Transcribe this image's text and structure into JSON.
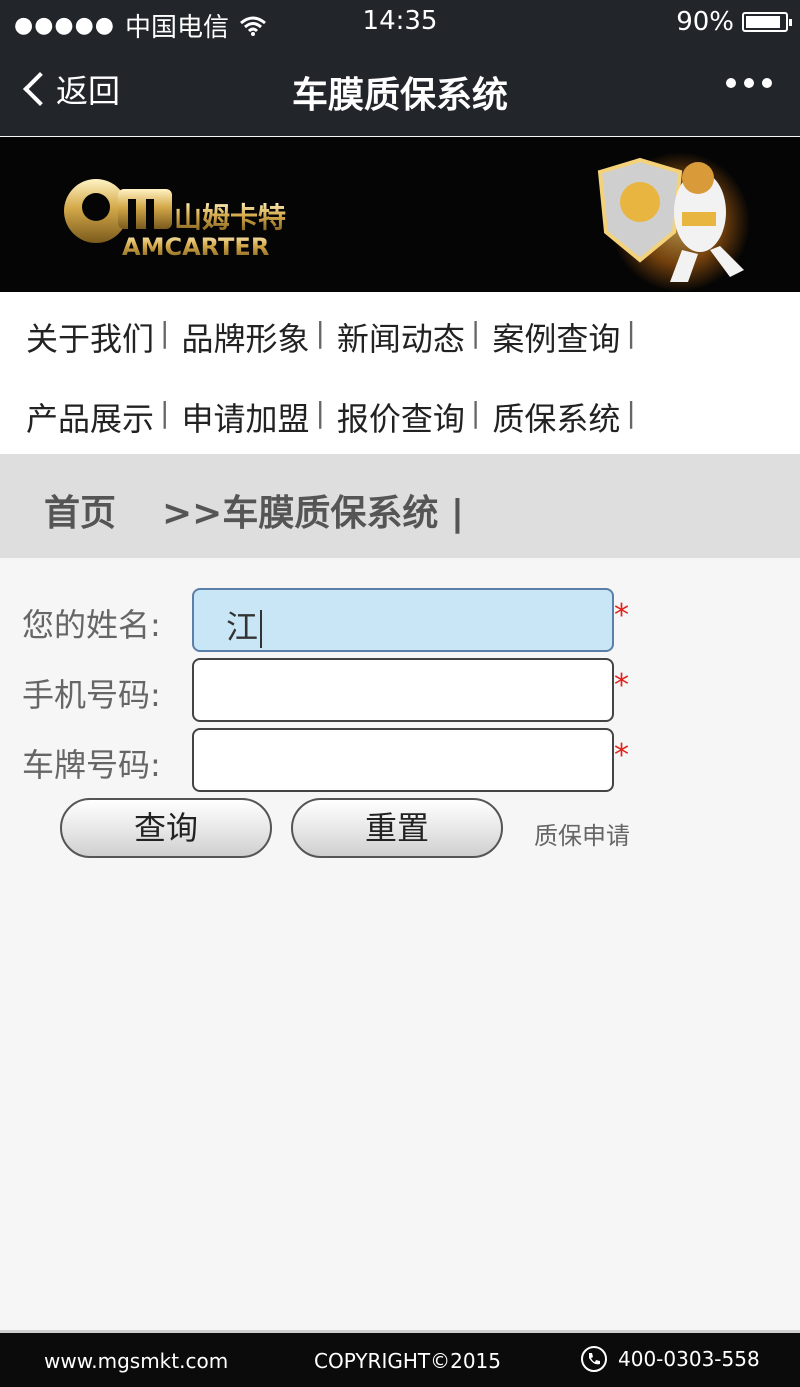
{
  "status_bar": {
    "carrier": "中国电信",
    "time": "14:35",
    "battery": "90%",
    "battery_level": 0.9
  },
  "nav": {
    "back_label": "返回",
    "title": "车膜质保系统",
    "more_icon": "ellipsis-icon"
  },
  "banner": {
    "logo_cn": "山姆卡特",
    "logo_en": "AMCARTER"
  },
  "menu": {
    "row1": [
      "关于我们",
      "品牌形象",
      "新闻动态",
      "案例查询"
    ],
    "row2": [
      "产品展示",
      "申请加盟",
      "报价查询",
      "质保系统"
    ],
    "separator": "|"
  },
  "breadcrumb": {
    "home": "首页",
    "current": ">>车膜质保系统 |"
  },
  "form": {
    "name_label": "您的姓名:",
    "name_value": "江",
    "phone_label": "手机号码:",
    "phone_value": "",
    "plate_label": "车牌号码:",
    "plate_value": "",
    "required_mark": "*",
    "query_button": "查询",
    "reset_button": "重置",
    "apply_link": "质保申请"
  },
  "footer": {
    "website": "www.mgsmkt.com",
    "copyright": "COPYRIGHT©2015",
    "phone": "400-0303-558"
  },
  "colors": {
    "bar_bg": "#22262b",
    "active_field": "#c8e6f5",
    "required": "#e0221b",
    "breadcrumb_bg": "#dedede"
  }
}
